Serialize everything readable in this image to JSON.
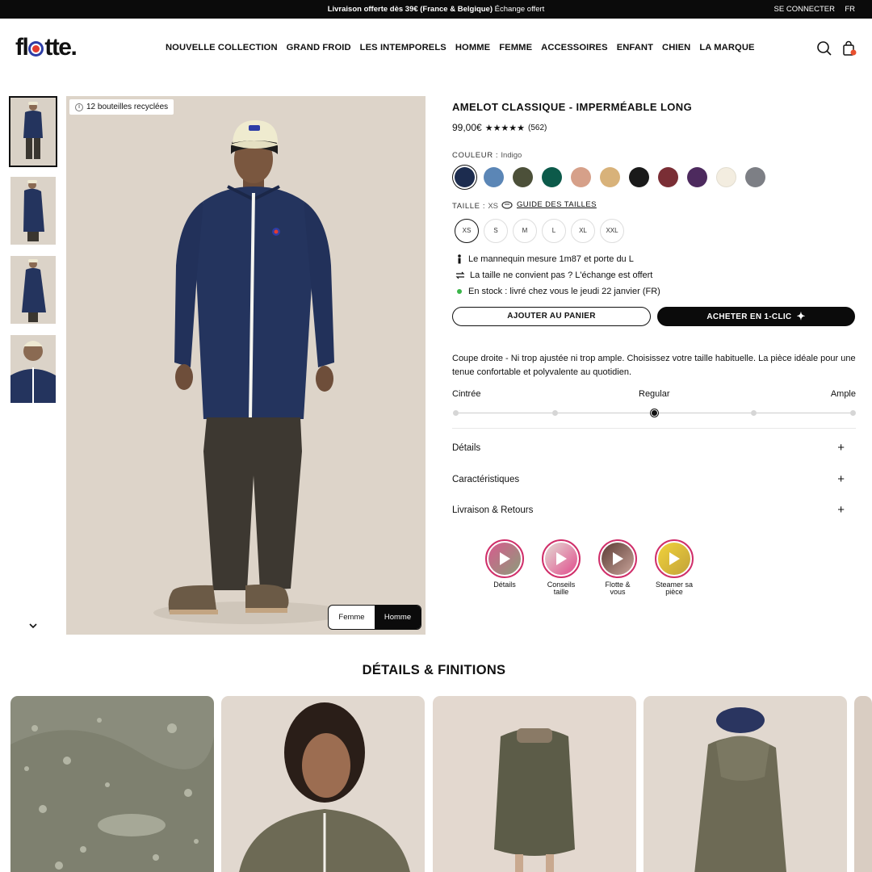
{
  "announcement": {
    "promo_bold": "Livraison offerte dès 39€ (France & Belgique)",
    "promo_rest": "Échange offert",
    "login": "SE CONNECTER",
    "lang": "FR"
  },
  "header": {
    "logo": "flotte.",
    "nav": [
      "NOUVELLE COLLECTION",
      "GRAND FROID",
      "LES INTEMPORELS",
      "HOMME",
      "FEMME",
      "ACCESSOIRES",
      "ENFANT",
      "CHIEN",
      "LA MARQUE"
    ],
    "icons": [
      "search-icon",
      "cart-icon"
    ]
  },
  "gallery": {
    "badge": "12 bouteilles recyclées",
    "gender_toggle": [
      "Femme",
      "Homme"
    ],
    "selected_gender": "Homme"
  },
  "product": {
    "title": "AMELOT CLASSIQUE - IMPERMÉABLE LONG",
    "price": "99,00€",
    "stars": "★★★★★",
    "reviews": "(562)",
    "color_label": "COULEUR :",
    "color_value": "Indigo",
    "colors": [
      "#1c2c4f",
      "#5b86b6",
      "#4c5039",
      "#0c5a4a",
      "#d6a089",
      "#d8b27a",
      "#1a1a1a",
      "#7a2e35",
      "#4d2a5e",
      "#f3ede0",
      "#7d7f85"
    ],
    "size_label": "TAILLE :",
    "size_value": "XS",
    "size_guide": "GUIDE DES TAILLES",
    "sizes": [
      "XS",
      "S",
      "M",
      "L",
      "XL",
      "XXL"
    ],
    "info": [
      "Le mannequin mesure 1m87 et porte du L",
      "La taille ne convient pas ? L'échange est offert",
      "En stock : livré chez vous le jeudi 22 janvier (FR)"
    ],
    "add_to_cart": "AJOUTER AU PANIER",
    "buy_one_click": "ACHETER EN 1-CLIC",
    "fit_description": "Coupe droite - Ni trop ajustée ni trop ample. Choisissez votre taille habituelle. La pièce idéale pour une tenue confortable et polyvalente au quotidien.",
    "fit_labels": [
      "Cintrée",
      "Regular",
      "Ample"
    ],
    "fit_level": 0.5,
    "accordions": [
      "Détails",
      "Caractéristiques",
      "Livraison & Retours"
    ],
    "stories": [
      "Détails",
      "Conseils taille",
      "Flotte & vous",
      "Steamer sa pièce"
    ]
  },
  "details_section": {
    "title": "DÉTAILS & FINITIONS"
  }
}
